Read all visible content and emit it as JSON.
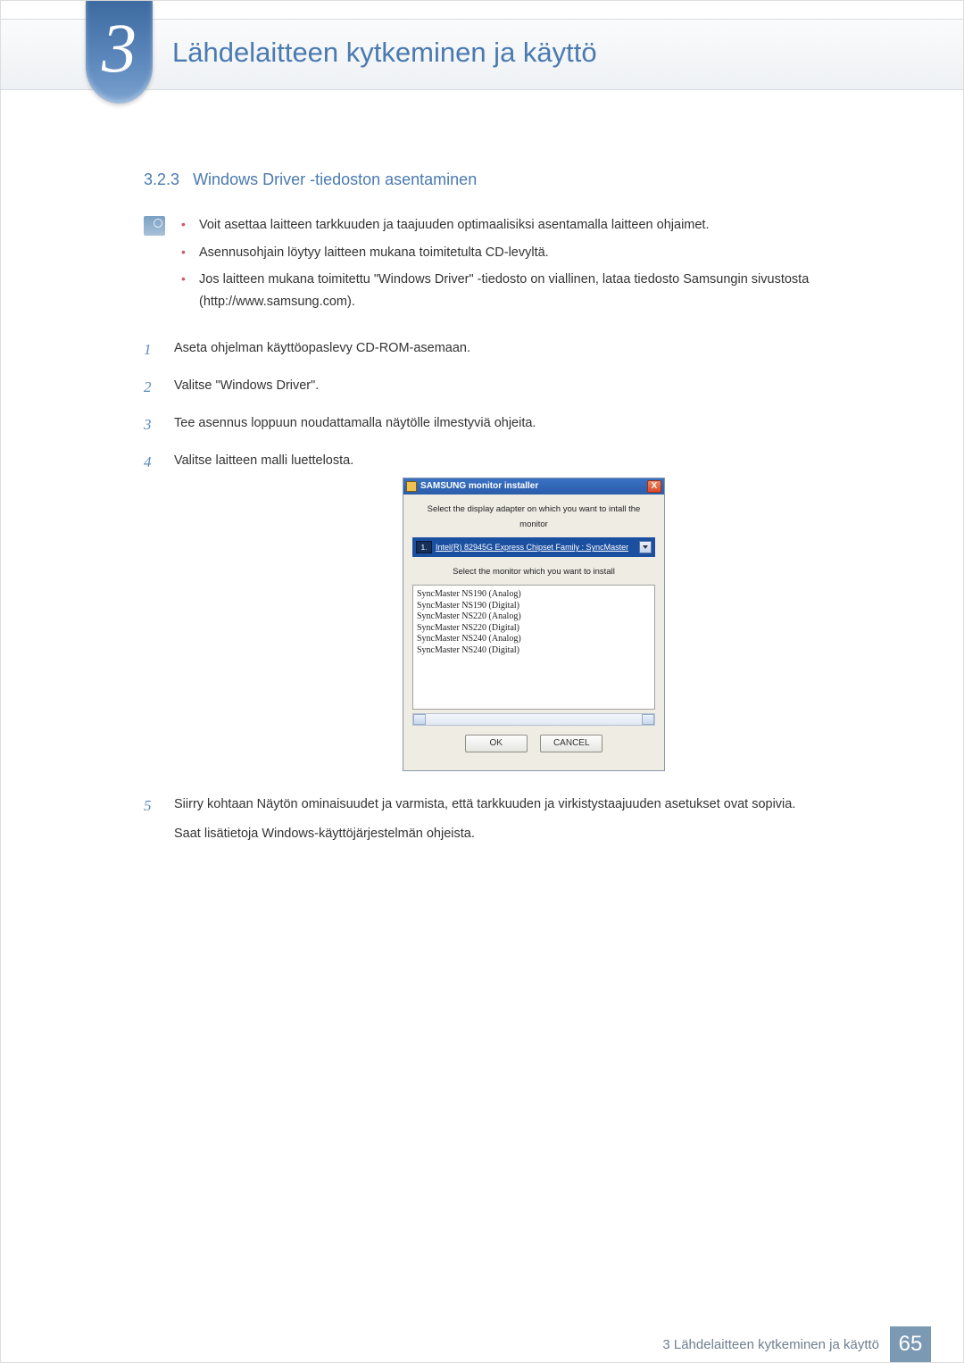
{
  "header": {
    "chapter_number": "3",
    "chapter_title": "Lähdelaitteen kytkeminen ja käyttö"
  },
  "section": {
    "number": "3.2.3",
    "title": "Windows Driver -tiedoston asentaminen"
  },
  "note_bullets": [
    "Voit asettaa laitteen tarkkuuden ja taajuuden optimaalisiksi asentamalla laitteen ohjaimet.",
    "Asennusohjain löytyy laitteen mukana toimitetulta CD-levyltä.",
    "Jos laitteen mukana toimitettu \"Windows Driver\" -tiedosto on viallinen, lataa tiedosto Samsungin sivustosta (http://www.samsung.com)."
  ],
  "steps": [
    {
      "n": "1",
      "text": "Aseta ohjelman käyttöopas­levy CD-ROM-asemaan."
    },
    {
      "n": "2",
      "text": "Valitse \"Windows Driver\"."
    },
    {
      "n": "3",
      "text": "Tee asennus loppuun noudattamalla näytölle ilmestyviä ohjeita."
    },
    {
      "n": "4",
      "text": "Valitse laitteen malli luettelosta."
    },
    {
      "n": "5",
      "text": "Siirry kohtaan Näytön ominaisuudet ja varmista, että tarkkuuden ja virkistystaajuuden asetukset ovat sopivia.",
      "extra": "Saat lisätietoja Windows-käyttöjärjestelmän ohjeista."
    }
  ],
  "dialog": {
    "title": "SAMSUNG monitor installer",
    "label_adapter": "Select the display adapter on which you want to intall the monitor",
    "adapter_index": "1.",
    "adapter_text": "Intel(R) 82945G Express Chipset Family : SyncMaster",
    "label_monitor": "Select the monitor which you want to install",
    "monitors": [
      "SyncMaster NS190 (Analog)",
      "SyncMaster NS190 (Digital)",
      "SyncMaster NS220 (Analog)",
      "SyncMaster NS220 (Digital)",
      "SyncMaster NS240 (Analog)",
      "SyncMaster NS240 (Digital)"
    ],
    "ok": "OK",
    "cancel": "CANCEL",
    "close": "X"
  },
  "footer": {
    "text": "3 Lähdelaitteen kytkeminen ja käyttö",
    "page": "65"
  }
}
